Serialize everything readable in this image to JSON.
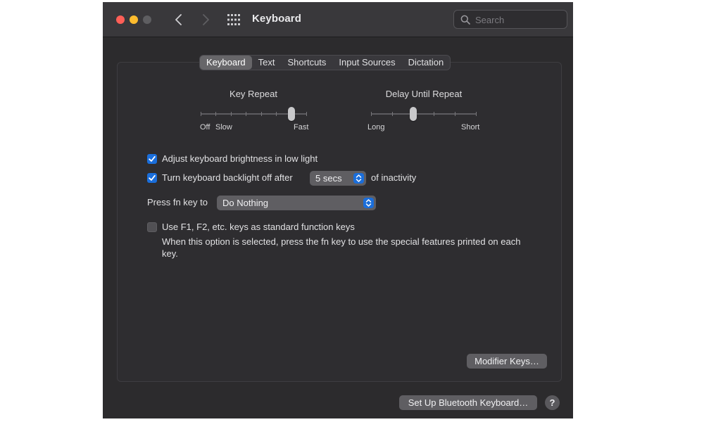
{
  "window": {
    "title": "Keyboard"
  },
  "search": {
    "placeholder": "Search"
  },
  "tabs": [
    {
      "label": "Keyboard",
      "active": true
    },
    {
      "label": "Text"
    },
    {
      "label": "Shortcuts"
    },
    {
      "label": "Input Sources"
    },
    {
      "label": "Dictation"
    }
  ],
  "key_repeat": {
    "title": "Key Repeat",
    "label_off": "Off",
    "label_slow": "Slow",
    "label_fast": "Fast",
    "stops": 8,
    "selected_stop": 7
  },
  "delay_until_repeat": {
    "title": "Delay Until Repeat",
    "label_long": "Long",
    "label_short": "Short",
    "stops": 6,
    "selected_stop": 3
  },
  "options": {
    "adjust_brightness": {
      "label": "Adjust keyboard brightness in low light",
      "checked": true
    },
    "backlight_off": {
      "label": "Turn keyboard backlight off after",
      "checked": true,
      "value": "5 secs",
      "suffix": "of inactivity"
    },
    "fn_key": {
      "label": "Press fn key to",
      "value": "Do Nothing"
    },
    "function_keys": {
      "label": "Use F1, F2, etc. keys as standard function keys",
      "checked": false,
      "description": "When this option is selected, press the fn key to use the special features printed on each key."
    }
  },
  "buttons": {
    "modifier_keys": "Modifier Keys…",
    "bluetooth_keyboard": "Set Up Bluetooth Keyboard…",
    "help": "?"
  },
  "colors": {
    "accent": "#1a6edb",
    "window_bg": "#2c2b2d",
    "titlebar_bg": "#39383b"
  }
}
